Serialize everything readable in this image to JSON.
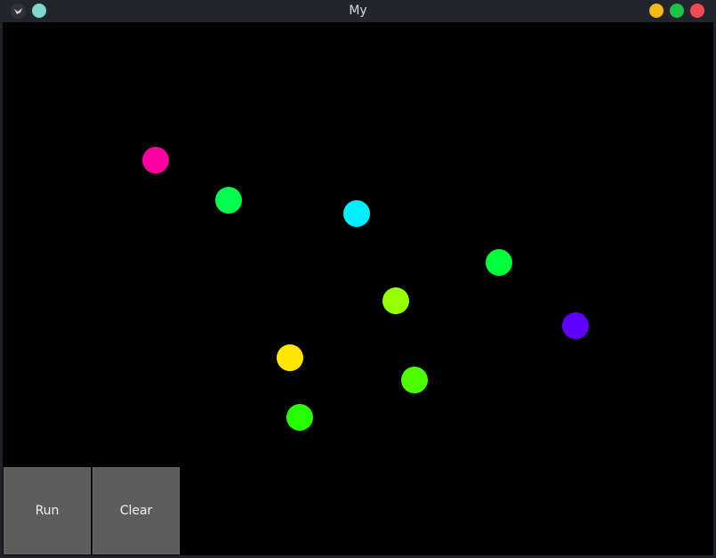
{
  "window": {
    "title": "My"
  },
  "titlebar": {
    "app_icon": "kivy-logo-icon",
    "pin_icon": "pin-dot-icon",
    "buttons": [
      {
        "name": "minimize",
        "color": "#f4b91a"
      },
      {
        "name": "maximize",
        "color": "#1ec14a"
      },
      {
        "name": "close",
        "color": "#f34b55"
      }
    ]
  },
  "canvas": {
    "background": "#000000",
    "balls": [
      {
        "color": "#ff00a0"
      },
      {
        "color": "#00ff4e"
      },
      {
        "color": "#00eeff"
      },
      {
        "color": "#00ff3a"
      },
      {
        "color": "#96ff00"
      },
      {
        "color": "#6000ff"
      },
      {
        "color": "#ffe600"
      },
      {
        "color": "#4cff00"
      },
      {
        "color": "#27ff00"
      }
    ]
  },
  "controls": {
    "run_label": "Run",
    "clear_label": "Clear"
  }
}
